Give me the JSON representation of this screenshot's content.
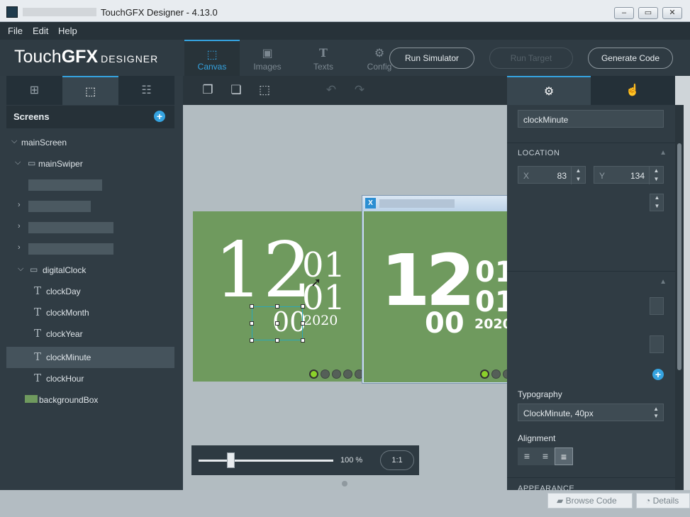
{
  "window": {
    "title": "TouchGFX Designer - 4.13.0",
    "buttons": [
      "‒",
      "▭",
      "✕"
    ]
  },
  "menu": {
    "file": "File",
    "edit": "Edit",
    "help": "Help"
  },
  "brand": {
    "part1": "Touch",
    "part2": "GFX",
    "part3": "DESIGNER"
  },
  "header_tabs": [
    {
      "label": "Canvas",
      "icon": "canvas-icon"
    },
    {
      "label": "Images",
      "icon": "images-icon"
    },
    {
      "label": "Texts",
      "icon": "texts-icon"
    },
    {
      "label": "Config",
      "icon": "config-icon"
    }
  ],
  "header_buttons": {
    "run_simulator": "Run Simulator",
    "run_target": "Run Target",
    "generate_code": "Generate Code"
  },
  "left_panel": {
    "title": "Screens",
    "tree": [
      {
        "label": "mainScreen",
        "level": 0
      },
      {
        "label": "mainSwiper",
        "level": 1
      },
      {
        "label": "digitalClock",
        "level": 1
      },
      {
        "label": "clockDay",
        "level": 2
      },
      {
        "label": "clockMonth",
        "level": 2
      },
      {
        "label": "clockYear",
        "level": 2
      },
      {
        "label": "clockMinute",
        "level": 2,
        "selected": true
      },
      {
        "label": "clockHour",
        "level": 2
      },
      {
        "label": "backgroundBox",
        "level": 1
      }
    ]
  },
  "canvas": {
    "clock_hour": "12",
    "clock_day": "01",
    "clock_month": "01",
    "clock_minute": "00",
    "clock_year": "2020",
    "zoom_percent": "100 %",
    "zoom_reset": "1:1",
    "zoom_level": 1.0
  },
  "simulator": {
    "clock_hour": "12",
    "clock_day": "01",
    "clock_month": "01",
    "clock_minute": "00",
    "clock_year": "2020",
    "buttons": [
      "‒",
      "▭",
      "✕"
    ]
  },
  "properties": {
    "name": "clockMinute",
    "location_title": "LOCATION",
    "x_label": "X",
    "x_value": "83",
    "y_label": "Y",
    "y_value": "134",
    "typography_label": "Typography",
    "typography_value": "ClockMinute, 40px",
    "alignment_label": "Alignment",
    "appearance_title": "APPEARANCE"
  },
  "status_buttons": {
    "browse_code": "Browse Code",
    "details": "Details"
  },
  "colors": {
    "accent": "#35a3e0",
    "panel": "#303c44",
    "screen_green": "#6f9a5e",
    "active_dot": "#8bd12a"
  }
}
